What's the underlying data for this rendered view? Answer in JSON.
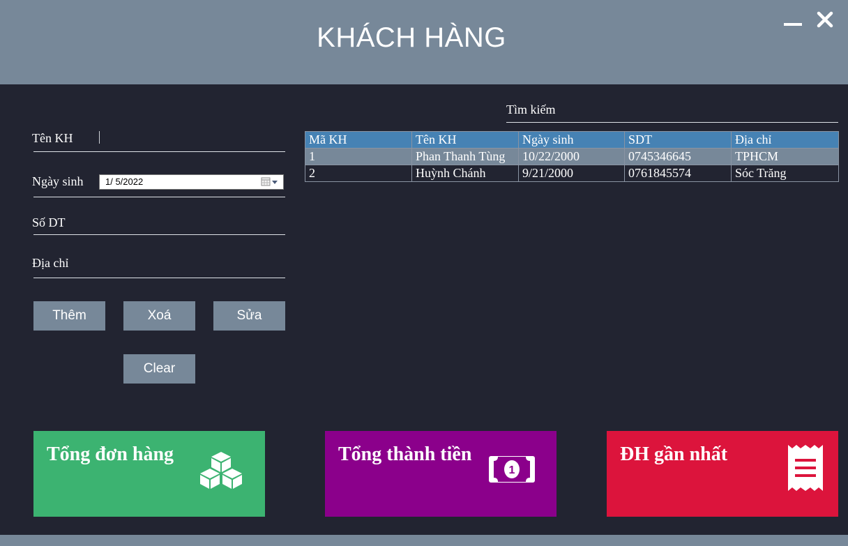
{
  "window": {
    "title": "KHÁCH HÀNG",
    "minimize_icon": "minimize-icon",
    "close_icon": "close-icon"
  },
  "form": {
    "name_label": "Tên KH",
    "name_value": "",
    "dob_label": "Ngày sinh",
    "dob_value": "1/  5/2022",
    "phone_label": "Số DT",
    "phone_value": "",
    "address_label": "Địa chỉ",
    "address_value": ""
  },
  "buttons": {
    "add": "Thêm",
    "delete": "Xoá",
    "edit": "Sửa",
    "clear": "Clear"
  },
  "search": {
    "label": "Tìm kiếm",
    "value": ""
  },
  "table": {
    "columns": [
      "Mã KH",
      "Tên KH",
      "Ngày sinh",
      "SDT",
      "Địa chỉ"
    ],
    "rows": [
      [
        "1",
        "Phan Thanh Tùng",
        "10/22/2000",
        "0745346645",
        "TPHCM"
      ],
      [
        "2",
        "Huỳnh Chánh",
        "9/21/2000",
        "0761845574",
        "Sóc Trăng"
      ]
    ],
    "selected_row": 0
  },
  "tiles": [
    {
      "label": "Tổng đơn hàng",
      "icon": "boxes-icon",
      "color": "#3cb371"
    },
    {
      "label": "Tổng thành tiền",
      "icon": "money-bill-icon",
      "color": "#8b008b"
    },
    {
      "label": "ĐH gần nhất",
      "icon": "receipt-icon",
      "color": "#dc143c"
    }
  ],
  "colors": {
    "background": "#222431",
    "header": "#778899",
    "table_header": "#4682b4",
    "selected_row": "#778899"
  }
}
